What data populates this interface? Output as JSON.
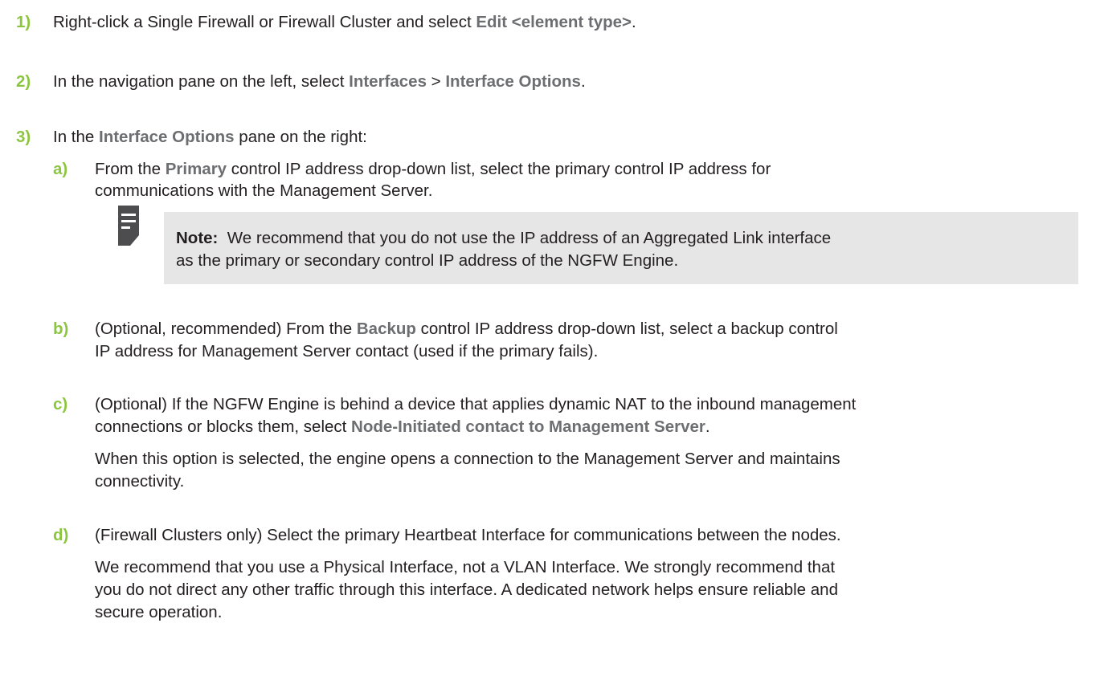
{
  "colors": {
    "step_number": "#8cc63f",
    "ui_term": "#6d6e71",
    "note_background": "#e6e6e6",
    "note_icon": "#4d4d4f"
  },
  "steps": [
    {
      "number": "1)",
      "lines": [
        {
          "p1": "Right-click a Single Firewall or Firewall Cluster and select ",
          "t1": "Edit <element type>",
          "p2": "."
        }
      ]
    },
    {
      "number": "2)",
      "lines": [
        {
          "p1": "In the navigation pane on the left, select ",
          "t1": "Interfaces",
          "p2": " > ",
          "t2": "Interface Options",
          "p3": "."
        }
      ]
    },
    {
      "number": "3)",
      "lines": [
        {
          "p1": "In the ",
          "t1": "Interface Options",
          "p2": " pane on the right:"
        }
      ]
    }
  ],
  "substeps": [
    {
      "letter": "a)",
      "lines": [
        {
          "p1": "From the ",
          "t1": "Primary",
          "p2": " control IP address drop-down list, select the primary control IP address for"
        },
        {
          "p1": "communications with the Management Server."
        }
      ],
      "note": {
        "label": "Note:",
        "lines": [
          "We recommend that you do not use the IP address of an Aggregated Link interface",
          "as the primary or secondary control IP address of the NGFW Engine."
        ]
      }
    },
    {
      "letter": "b)",
      "lines": [
        {
          "p1": "(Optional, recommended) From the ",
          "t1": "Backup",
          "p2": " control IP address drop-down list, select a backup control"
        },
        {
          "p1": "IP address for Management Server contact (used if the primary fails)."
        }
      ]
    },
    {
      "letter": "c)",
      "lines": [
        {
          "p1": "(Optional) If the NGFW Engine is behind a device that applies dynamic NAT to the inbound management"
        },
        {
          "p1": "connections or blocks them, select ",
          "t1": "Node-Initiated contact to Management Server",
          "p2": "."
        },
        {
          "p1": "When this option is selected, the engine opens a connection to the Management Server and maintains"
        },
        {
          "p1": "connectivity."
        }
      ]
    },
    {
      "letter": "d)",
      "lines": [
        {
          "p1": "(Firewall Clusters only) Select the primary Heartbeat Interface for communications between the nodes."
        },
        {
          "p1": "We recommend that you use a Physical Interface, not a VLAN Interface. We strongly recommend that"
        },
        {
          "p1": "you do not direct any other traffic through this interface. A dedicated network helps ensure reliable and"
        },
        {
          "p1": "secure operation."
        }
      ]
    }
  ]
}
